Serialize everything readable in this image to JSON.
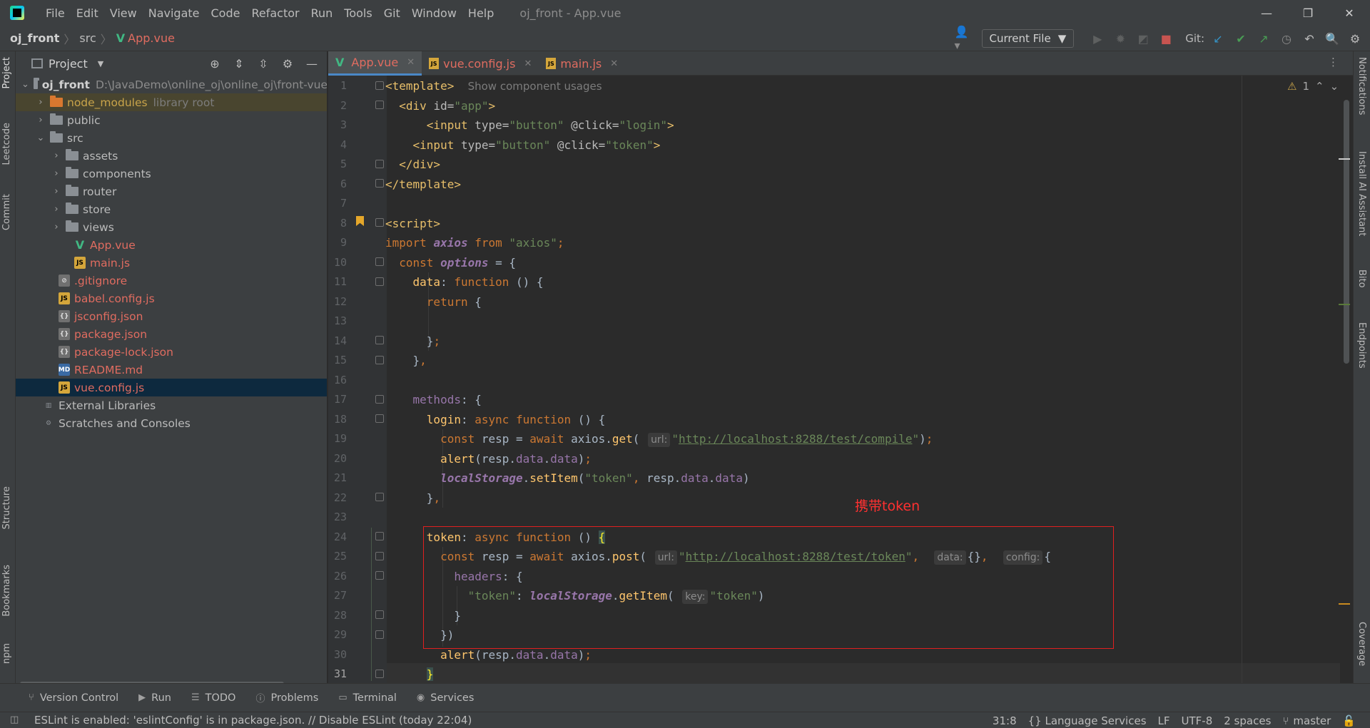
{
  "menu": [
    "File",
    "Edit",
    "View",
    "Navigate",
    "Code",
    "Refactor",
    "Run",
    "Tools",
    "Git",
    "Window",
    "Help"
  ],
  "window_title": "oj_front - App.vue",
  "breadcrumb": {
    "project": "oj_front",
    "folder": "src",
    "file": "App.vue"
  },
  "toolbar": {
    "run_config": "Current File",
    "git_label": "Git:"
  },
  "left_tabs": [
    "Project",
    "Leetcode",
    "Commit",
    "Structure",
    "Bookmarks",
    "npm"
  ],
  "right_tabs": [
    "Notifications",
    "Install AI Assistant",
    "Bito",
    "Endpoints",
    "Coverage"
  ],
  "project_panel": {
    "title": "Project",
    "root": {
      "name": "oj_front",
      "path": "D:\\JavaDemo\\online_oj\\online_oj\\front-vue"
    },
    "items": [
      {
        "label": "node_modules",
        "hint": "library root"
      },
      {
        "label": "public"
      },
      {
        "label": "src"
      },
      {
        "label": "assets"
      },
      {
        "label": "components"
      },
      {
        "label": "router"
      },
      {
        "label": "store"
      },
      {
        "label": "views"
      },
      {
        "label": "App.vue"
      },
      {
        "label": "main.js"
      },
      {
        "label": ".gitignore"
      },
      {
        "label": "babel.config.js"
      },
      {
        "label": "jsconfig.json"
      },
      {
        "label": "package.json"
      },
      {
        "label": "package-lock.json"
      },
      {
        "label": "README.md"
      },
      {
        "label": "vue.config.js"
      },
      {
        "label": "External Libraries"
      },
      {
        "label": "Scratches and Consoles"
      }
    ]
  },
  "tabs": [
    {
      "label": "App.vue"
    },
    {
      "label": "vue.config.js"
    },
    {
      "label": "main.js"
    }
  ],
  "editor": {
    "line_numbers": [
      "1",
      "2",
      "3",
      "4",
      "5",
      "6",
      "7",
      "8",
      "9",
      "10",
      "11",
      "12",
      "13",
      "14",
      "15",
      "16",
      "17",
      "18",
      "19",
      "20",
      "21",
      "22",
      "23",
      "24",
      "25",
      "26",
      "27",
      "28",
      "29",
      "30",
      "31"
    ],
    "show_usages": "Show component usages",
    "warning_count": "1",
    "url_compile": "http://localhost:8288/test/compile",
    "url_token": "http://localhost:8288/test/token",
    "hint_url": "url:",
    "hint_data": "data:",
    "hint_config": "config:",
    "hint_key": "key:"
  },
  "annotation": "携带token",
  "tool_windows": [
    "Version Control",
    "Run",
    "TODO",
    "Problems",
    "Terminal",
    "Services"
  ],
  "status": {
    "message": "ESLint is enabled: 'eslintConfig' is in package.json. // Disable ESLint (today 22:04)",
    "position": "31:8",
    "language_services": "{} Language Services",
    "line_sep": "LF",
    "encoding": "UTF-8",
    "indent": "2 spaces",
    "branch": "master"
  }
}
